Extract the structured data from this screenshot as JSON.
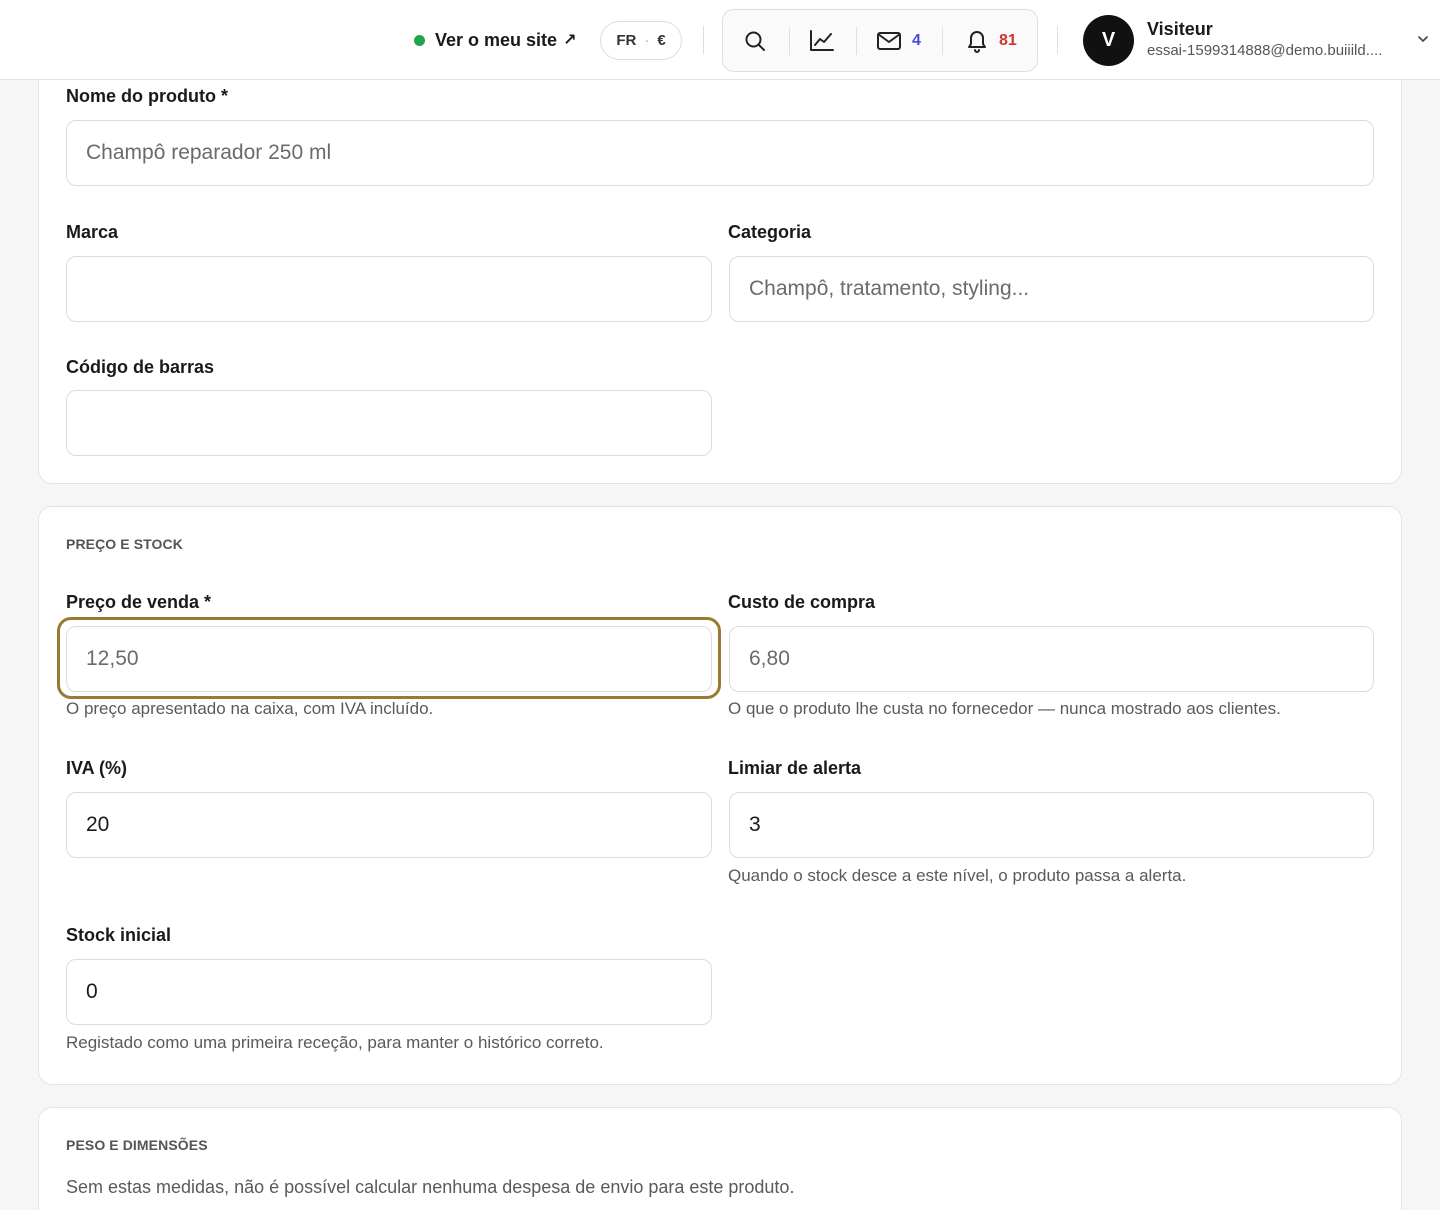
{
  "header": {
    "site_link": "Ver o meu site",
    "site_link_arrow": "↗",
    "language": "FR",
    "lang_sep": "·",
    "currency": "€",
    "messages_count": "4",
    "notifications_count": "81",
    "user": {
      "initial": "V",
      "name": "Visiteur",
      "email": "essai-1599314888@demo.buiiild...."
    }
  },
  "product": {
    "name_label": "Nome do produto *",
    "name_placeholder": "Champô reparador 250 ml",
    "brand_label": "Marca",
    "brand_value": "",
    "category_label": "Categoria",
    "category_placeholder": "Champô, tratamento, styling...",
    "barcode_label": "Código de barras",
    "barcode_value": ""
  },
  "price_stock": {
    "section_title": "PREÇO E STOCK",
    "sale_price_label": "Preço de venda *",
    "sale_price_placeholder": "12,50",
    "sale_price_help": "O preço apresentado na caixa, com IVA incluído.",
    "cost_label": "Custo de compra",
    "cost_placeholder": "6,80",
    "cost_help": "O que o produto lhe custa no fornecedor — nunca mostrado aos clientes.",
    "vat_label": "IVA (%)",
    "vat_value": "20",
    "alert_label": "Limiar de alerta",
    "alert_value": "3",
    "alert_help": "Quando o stock desce a este nível, o produto passa a alerta.",
    "initial_stock_label": "Stock inicial",
    "initial_stock_value": "0",
    "initial_stock_help": "Registado como uma primeira receção, para manter o histórico correto."
  },
  "weight_dims": {
    "section_title": "PESO E DIMENSÕES",
    "description": "Sem estas medidas, não é possível calcular nenhuma despesa de envio para este produto."
  }
}
